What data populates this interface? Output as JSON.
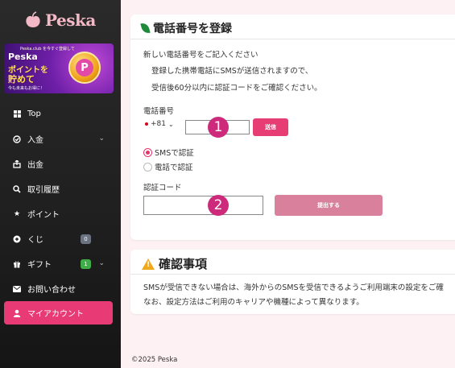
{
  "brand": {
    "logo_text": "Peska"
  },
  "banner": {
    "top": "Peska.club を今すぐ登録して",
    "line1": "Peska",
    "line2": "ポイントを",
    "line3": "貯めて",
    "sub": "今も未来もお得に！",
    "coin": "P"
  },
  "sidebar": {
    "items": [
      {
        "label": "Top",
        "icon": "grid-icon"
      },
      {
        "label": "入金",
        "icon": "deposit-icon"
      },
      {
        "label": "出金",
        "icon": "withdraw-icon"
      },
      {
        "label": "取引履歴",
        "icon": "search-icon"
      },
      {
        "label": "ポイント",
        "icon": "star-icon"
      },
      {
        "label": "くじ",
        "icon": "lottery-icon",
        "badge": "0"
      },
      {
        "label": "ギフト",
        "icon": "gift-icon",
        "badge": "1"
      },
      {
        "label": "お問い合わせ",
        "icon": "mail-icon"
      },
      {
        "label": "マイアカウント",
        "icon": "user-icon"
      }
    ],
    "colors": {
      "active": "#e83a75",
      "badge_green": "#3fae49",
      "badge_gray": "#6b7280"
    }
  },
  "phone_card": {
    "title": "電話番号を登録",
    "intro": "新しい電話番号をご記入ください",
    "line1": "登録した携帯電話にSMSが送信されますので、",
    "line2": "受信後60分以内に認証コードをご確認ください。",
    "phone_label": "電話番号",
    "country_code": "+81",
    "phone_value": "",
    "send_button": "送信",
    "radio_sms": "SMSで認証",
    "radio_call": "電話で認証",
    "radio_selected": "sms",
    "code_label": "認証コード",
    "code_value": "",
    "submit_button": "提出する"
  },
  "markers": {
    "m1": "1",
    "m2": "2"
  },
  "notice_card": {
    "title": "確認事項",
    "line1": "SMSが受信できない場合は、海外からのSMSを受信できるようご利用端末の設定をご確",
    "line2": "なお、設定方法はご利用のキャリアや機種によって異なります。"
  },
  "footer": {
    "copyright": "©2025 Peska"
  }
}
